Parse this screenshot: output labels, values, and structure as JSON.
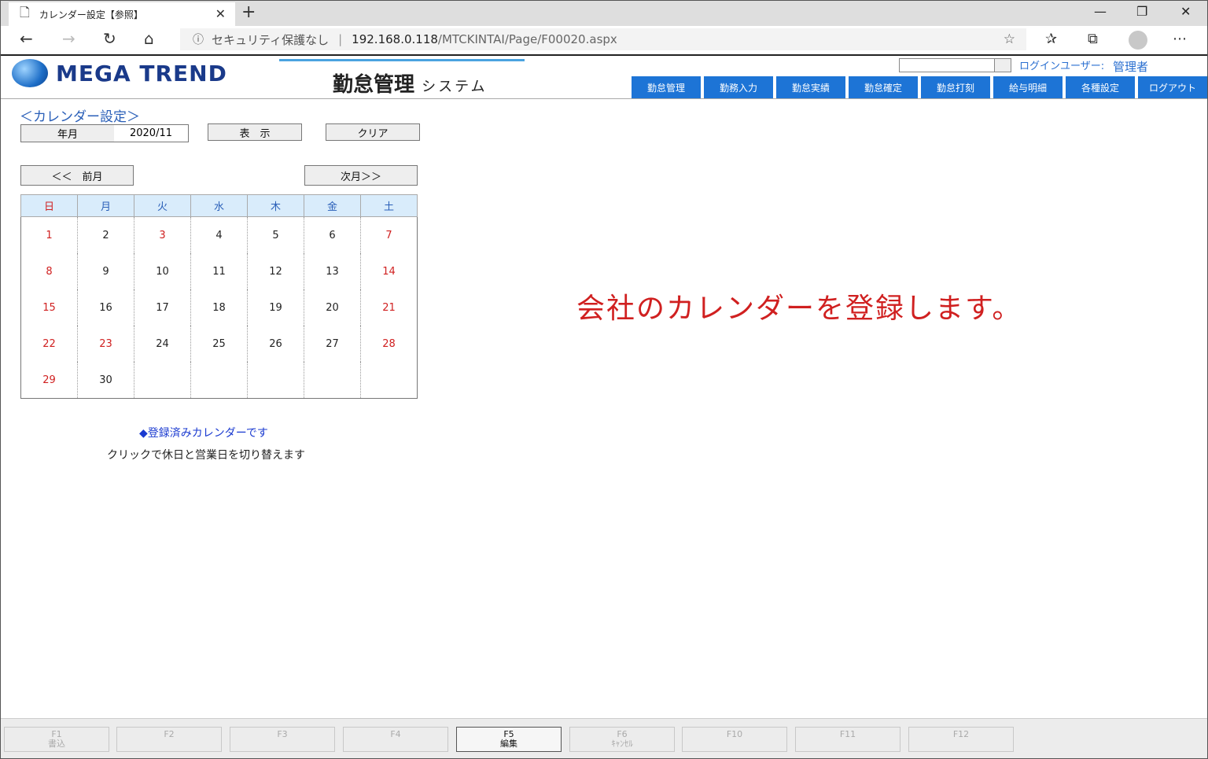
{
  "browser": {
    "tab_title": "カレンダー設定【参照】",
    "security_text": "セキュリティ保護なし",
    "url_host": "192.168.0.118",
    "url_path": "/MTCKINTAI/Page/F00020.aspx"
  },
  "header": {
    "logo_text": "MEGA TREND",
    "system_title_main": "勤怠管理",
    "system_title_sub": "システム",
    "login_label": "ログインユーザー:",
    "login_user": "管理者",
    "menu": [
      "勤怠管理",
      "勤務入力",
      "勤怠実績",
      "勤怠確定",
      "勤怠打刻",
      "給与明細",
      "各種設定",
      "ログアウト"
    ]
  },
  "main": {
    "section_title": "＜カレンダー設定＞",
    "ym_label": "年月",
    "ym_value": "2020/11",
    "show_button": "表　示",
    "clear_button": "クリア",
    "prev_button": "＜＜　前月",
    "next_button": "次月＞＞",
    "weekdays": [
      "日",
      "月",
      "火",
      "水",
      "木",
      "金",
      "土"
    ],
    "weeks": [
      [
        "1",
        "2",
        "3",
        "4",
        "5",
        "6",
        "7"
      ],
      [
        "8",
        "9",
        "10",
        "11",
        "12",
        "13",
        "14"
      ],
      [
        "15",
        "16",
        "17",
        "18",
        "19",
        "20",
        "21"
      ],
      [
        "22",
        "23",
        "24",
        "25",
        "26",
        "27",
        "28"
      ],
      [
        "29",
        "30",
        "",
        "",
        "",
        "",
        ""
      ]
    ],
    "holidays": [
      "1",
      "3",
      "7",
      "8",
      "14",
      "15",
      "21",
      "22",
      "23",
      "28",
      "29"
    ],
    "holiday_color": "#d02020",
    "registered_note": "◆登録済みカレンダーです",
    "click_note": "クリックで休日と営業日を切り替えます",
    "annotation": "会社のカレンダーを登録します。"
  },
  "footer": {
    "keys": [
      {
        "key": "F1",
        "label": "書込",
        "active": false
      },
      {
        "key": "F2",
        "label": "",
        "active": false
      },
      {
        "key": "F3",
        "label": "",
        "active": false
      },
      {
        "key": "F4",
        "label": "",
        "active": false
      },
      {
        "key": "F5",
        "label": "編集",
        "active": true
      },
      {
        "key": "F6",
        "label": "ｷｬﾝｾﾙ",
        "active": false
      },
      {
        "key": "F10",
        "label": "",
        "active": false
      },
      {
        "key": "F11",
        "label": "",
        "active": false
      },
      {
        "key": "F12",
        "label": "",
        "active": false
      }
    ]
  }
}
